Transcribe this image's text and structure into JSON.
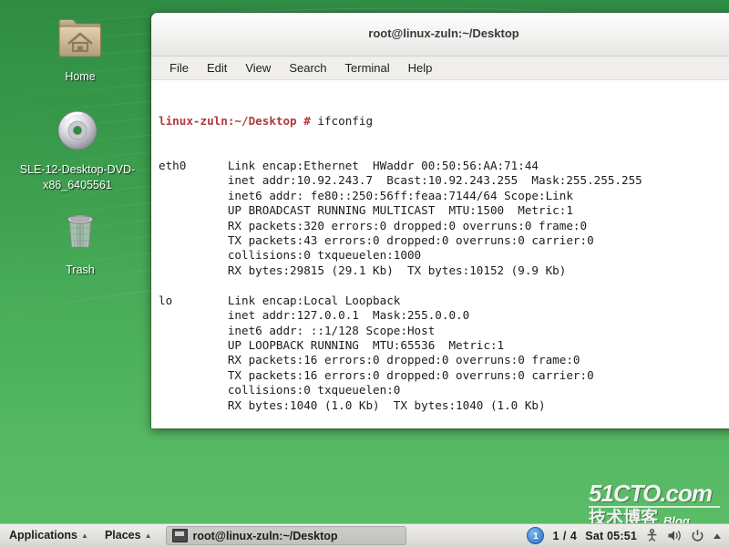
{
  "desktop": {
    "icons": [
      {
        "name": "home",
        "label": "Home",
        "icon": "folder-home-icon"
      },
      {
        "name": "dvd",
        "label": "SLE-12-Desktop-DVD-x86_6405561",
        "icon": "optical-disc-icon"
      },
      {
        "name": "trash",
        "label": "Trash",
        "icon": "trash-bin-icon"
      }
    ],
    "wallpaper_color": "#3a9c4c"
  },
  "watermark": {
    "top": "51CTO.com",
    "cn": "技术博客",
    "blog": "Blog"
  },
  "terminal": {
    "title": "root@linux-zuln:~/Desktop",
    "menus": [
      "File",
      "Edit",
      "View",
      "Search",
      "Terminal",
      "Help"
    ],
    "prompt": "linux-zuln:~/Desktop #",
    "prompt_color": "#b03a3a",
    "command": " ifconfig",
    "output_lines": [
      "eth0      Link encap:Ethernet  HWaddr 00:50:56:AA:71:44",
      "          inet addr:10.92.243.7  Bcast:10.92.243.255  Mask:255.255.255",
      "          inet6 addr: fe80::250:56ff:feaa:7144/64 Scope:Link",
      "          UP BROADCAST RUNNING MULTICAST  MTU:1500  Metric:1",
      "          RX packets:320 errors:0 dropped:0 overruns:0 frame:0",
      "          TX packets:43 errors:0 dropped:0 overruns:0 carrier:0",
      "          collisions:0 txqueuelen:1000",
      "          RX bytes:29815 (29.1 Kb)  TX bytes:10152 (9.9 Kb)",
      "",
      "lo        Link encap:Local Loopback",
      "          inet addr:127.0.0.1  Mask:255.0.0.0",
      "          inet6 addr: ::1/128 Scope:Host",
      "          UP LOOPBACK RUNNING  MTU:65536  Metric:1",
      "          RX packets:16 errors:0 dropped:0 overruns:0 frame:0",
      "          TX packets:16 errors:0 dropped:0 overruns:0 carrier:0",
      "          collisions:0 txqueuelen:0",
      "          RX bytes:1040 (1.0 Kb)  TX bytes:1040 (1.0 Kb)",
      ""
    ]
  },
  "taskbar": {
    "applications_label": "Applications",
    "places_label": "Places",
    "task_button_label": "root@linux-zuln:~/Desktop",
    "workspace_badge": "1",
    "workspace_count": "1 / 4",
    "clock": "Sat 05:51",
    "tray_icons": [
      "accessibility-icon",
      "volume-icon",
      "power-icon",
      "show-hidden-icon"
    ]
  }
}
